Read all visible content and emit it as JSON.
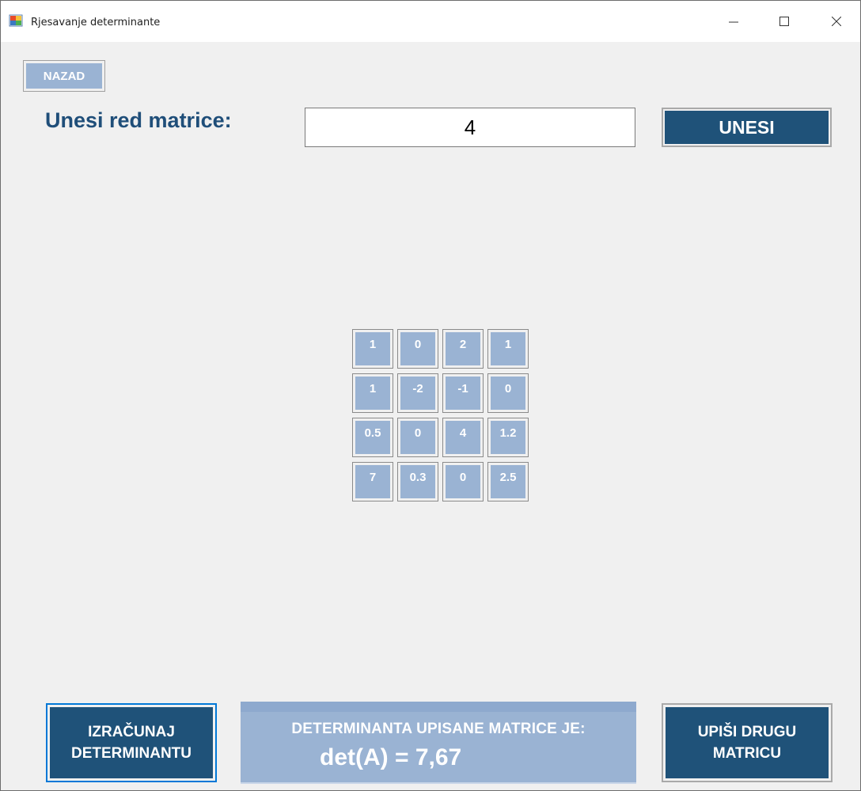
{
  "window": {
    "title": "Rjesavanje determinante",
    "icon": "winforms-app-icon"
  },
  "toolbar": {
    "back_label": "NAZAD"
  },
  "order_input": {
    "label": "Unesi red matrice:",
    "value": "4",
    "submit_label": "UNESI"
  },
  "matrix": {
    "rows": [
      [
        "1",
        "0",
        "2",
        "1"
      ],
      [
        "1",
        "-2",
        "-1",
        "0"
      ],
      [
        "0.5",
        "0",
        "4",
        "1.2"
      ],
      [
        "7",
        "0.3",
        "0",
        "2.5"
      ]
    ]
  },
  "actions": {
    "calculate_label": "IZRAČUNAJ\nDETERMINANTU",
    "new_matrix_label": "UPIŠI DRUGU\nMATRICU"
  },
  "result": {
    "label": "DETERMINANTA UPISANE MATRICE JE:",
    "value": "det(A) = 7,67"
  },
  "colors": {
    "accent_dark": "#1f5279",
    "accent_light": "#9ab3d3",
    "label_text": "#1f4e79",
    "focus_border": "#0078d7"
  }
}
